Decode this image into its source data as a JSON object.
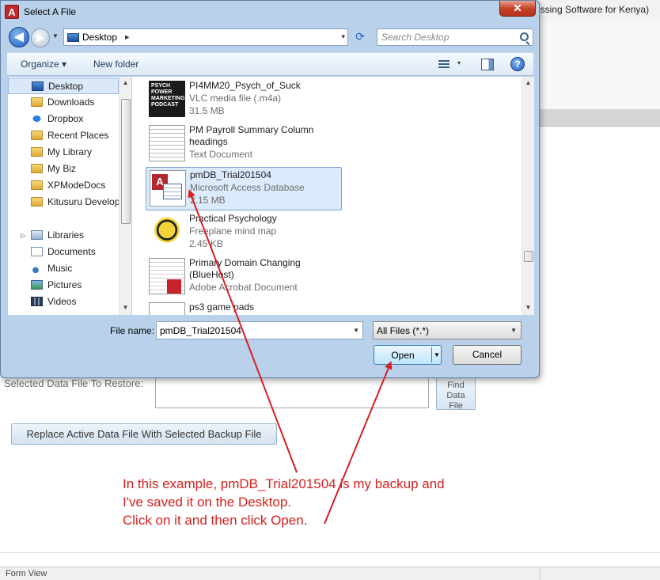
{
  "background_app": {
    "title_fragment": "essing Software for Kenya)",
    "restore_label": "Selected Data File To Restore:",
    "find_button": "Find\nData\nFile",
    "replace_button": "Replace Active Data File With Selected Backup File",
    "status_text": "Form View"
  },
  "dialog": {
    "app_icon_letter": "A",
    "title": "Select A File",
    "close_glyph": "✕",
    "address": {
      "location": "Desktop",
      "chevron": "▸",
      "dropdown": "▾"
    },
    "search_placeholder": "Search Desktop",
    "toolbar": {
      "organize": "Organize ▾",
      "new_folder": "New folder",
      "view_dropdown": "▾",
      "help": "?"
    },
    "nav": {
      "favorites": [
        {
          "label": "Desktop",
          "icon": "desktop-icon",
          "selected": true
        },
        {
          "label": "Downloads",
          "icon": "folder-icon"
        },
        {
          "label": "Dropbox",
          "icon": "dropbox-icon"
        },
        {
          "label": "Recent Places",
          "icon": "folder-icon"
        },
        {
          "label": "My Library",
          "icon": "folder-icon"
        },
        {
          "label": "My Biz",
          "icon": "folder-icon"
        },
        {
          "label": "XPModeDocs",
          "icon": "folder-icon"
        },
        {
          "label": "Kitusuru Develop",
          "icon": "folder-icon"
        }
      ],
      "libraries_label": "Libraries",
      "libraries": [
        {
          "label": "Documents",
          "icon": "document-icon"
        },
        {
          "label": "Music",
          "icon": "music-icon"
        },
        {
          "label": "Pictures",
          "icon": "pictures-icon"
        },
        {
          "label": "Videos",
          "icon": "videos-icon"
        }
      ]
    },
    "files": [
      {
        "name": "PI4MM20_Psych_of_Suck",
        "type": "VLC media file (.m4a)",
        "size": "31.5 MB",
        "thumb": "podcast",
        "thumb_text": "PSYCH POWER MARKETING PODCAST"
      },
      {
        "name": "PM Payroll Summary Column headings",
        "type": "Text Document",
        "size": "",
        "thumb": "text"
      },
      {
        "name": "pmDB_Trial201504",
        "type": "Microsoft Access Database",
        "size": "2.15 MB",
        "thumb": "access",
        "selected": true
      },
      {
        "name": "Practical Psychology",
        "type": "Freeplane mind map",
        "size": "2.45 KB",
        "thumb": "mindmap"
      },
      {
        "name": "Primary Domain Changing (BlueHost)",
        "type": "Adobe Acrobat Document",
        "size": "",
        "thumb": "pdf"
      },
      {
        "name": "ps3 game pads",
        "type": "",
        "size": "",
        "thumb": "generic"
      }
    ],
    "file_name_label": "File name:",
    "file_name_value": "pmDB_Trial201504",
    "filter_value": "All Files (*.*)",
    "open_label": "Open",
    "cancel_label": "Cancel"
  },
  "annotation": {
    "lines": [
      "In this example, pmDB_Trial201504 is my backup and",
      "I've saved it on the Desktop.",
      "Click on it and then click Open."
    ],
    "color": "#d62020"
  },
  "colors": {
    "dialog_frame": "#b9d1ea",
    "selection": "#dcebfc",
    "annotation": "#d62020"
  }
}
